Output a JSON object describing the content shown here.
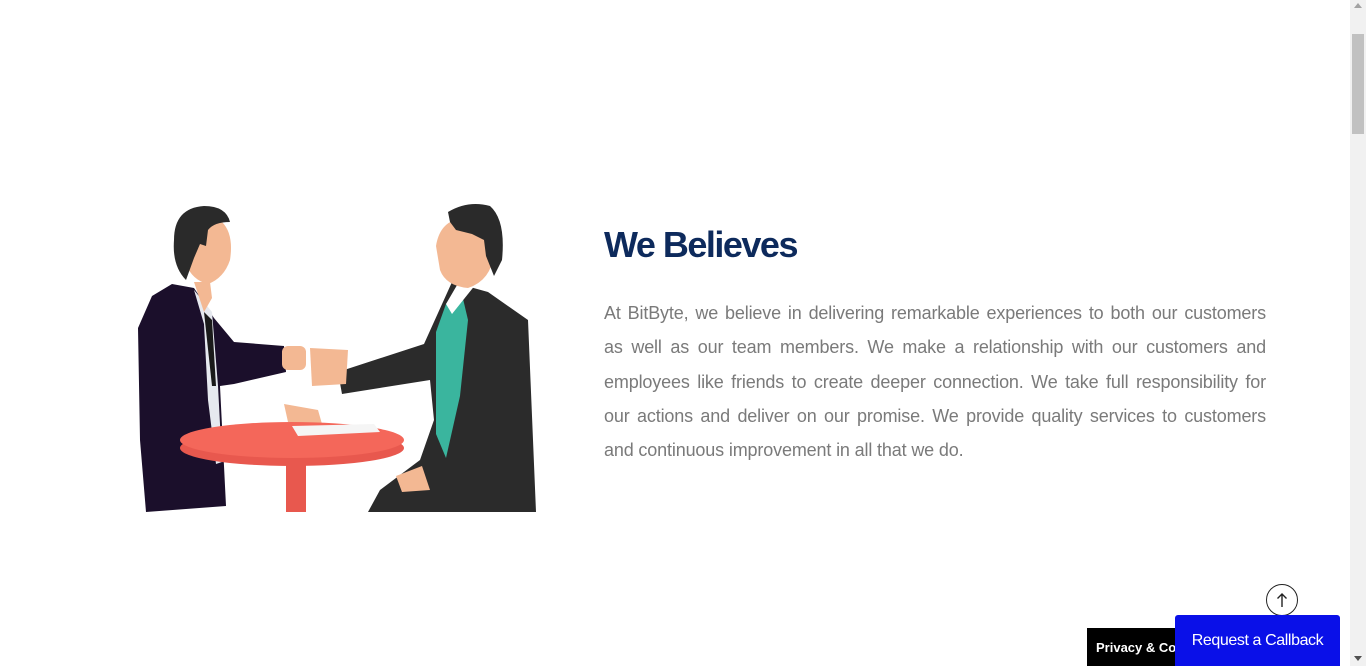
{
  "section": {
    "heading": "We Believes",
    "paragraph": "At BitByte, we believe in delivering remarkable experiences to both our customers as well as our team members. We make a relationship with our customers and employees like friends to create deeper connection. We take full responsibility for our actions and deliver on our promise. We provide quality services to customers and continuous improvement in all that we do."
  },
  "widgets": {
    "back_to_top_icon": "arrow-up-icon",
    "cookie_label": "Privacy & Cookies Policy",
    "callback_label": "Request a Callback"
  },
  "colors": {
    "heading": "#0d2a5c",
    "body_text": "#7a7a7a",
    "callback_bg": "#0a10e8",
    "cookie_bg": "#000000"
  }
}
